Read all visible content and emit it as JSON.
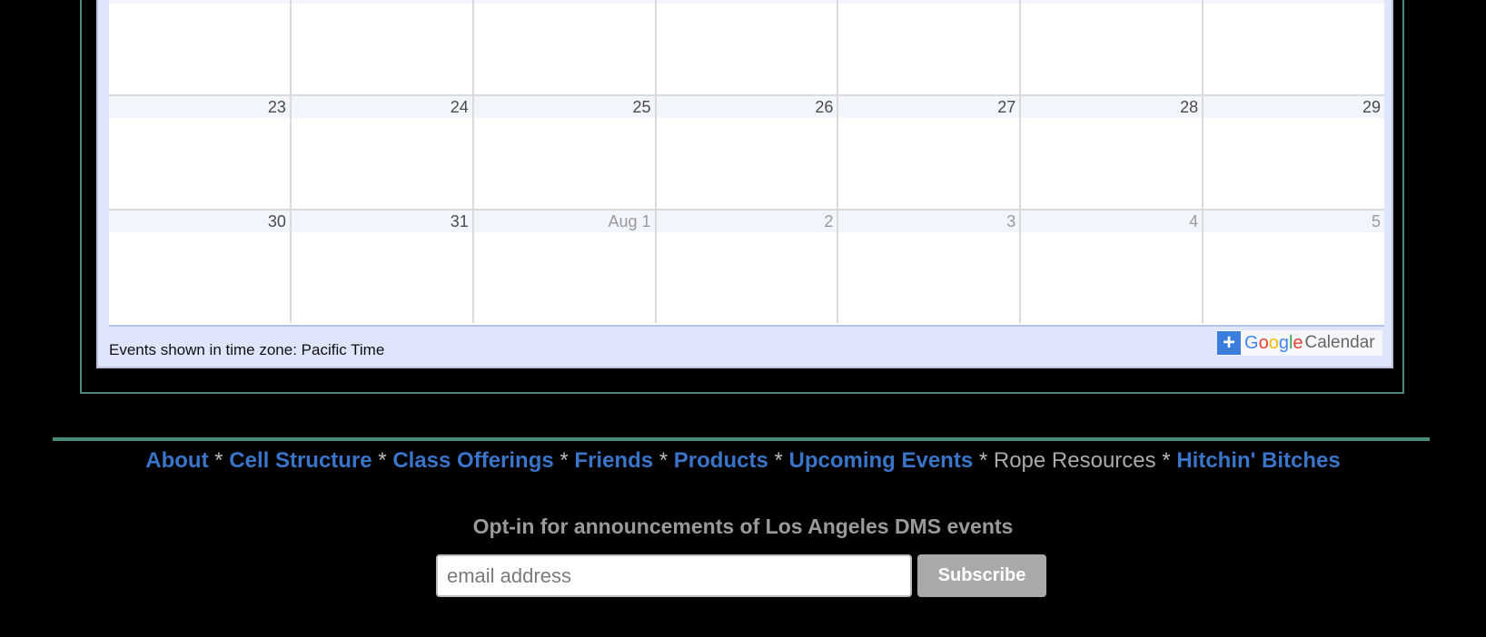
{
  "calendar": {
    "weeks": [
      {
        "days": [
          {
            "label": "",
            "other": false
          },
          {
            "label": "",
            "other": false
          },
          {
            "label": "",
            "other": false
          },
          {
            "label": "",
            "other": false
          },
          {
            "label": "",
            "other": false
          },
          {
            "label": "",
            "other": false
          },
          {
            "label": "",
            "other": false
          }
        ]
      },
      {
        "days": [
          {
            "label": "23",
            "other": false
          },
          {
            "label": "24",
            "other": false
          },
          {
            "label": "25",
            "other": false
          },
          {
            "label": "26",
            "other": false
          },
          {
            "label": "27",
            "other": false
          },
          {
            "label": "28",
            "other": false
          },
          {
            "label": "29",
            "other": false
          }
        ]
      },
      {
        "days": [
          {
            "label": "30",
            "other": false
          },
          {
            "label": "31",
            "other": false
          },
          {
            "label": "Aug 1",
            "other": true
          },
          {
            "label": "2",
            "other": true
          },
          {
            "label": "3",
            "other": true
          },
          {
            "label": "4",
            "other": true
          },
          {
            "label": "5",
            "other": true
          }
        ]
      }
    ],
    "timezone_text": "Events shown in time zone: Pacific Time",
    "gcal_badge": {
      "plus": "+",
      "google": "Google",
      "calendar": "Calendar"
    }
  },
  "footer": {
    "nav": [
      {
        "label": "About",
        "link": true
      },
      {
        "label": "Cell Structure",
        "link": true
      },
      {
        "label": "Class Offerings",
        "link": true
      },
      {
        "label": "Friends",
        "link": true
      },
      {
        "label": "Products",
        "link": true
      },
      {
        "label": "Upcoming Events",
        "link": true
      },
      {
        "label": "Rope Resources",
        "link": false
      },
      {
        "label": "Hitchin' Bitches",
        "link": true
      }
    ],
    "separator": "*"
  },
  "optin": {
    "title": "Opt-in for announcements of Los Angeles DMS events",
    "email_placeholder": "email address",
    "email_value": "",
    "subscribe_label": "Subscribe"
  }
}
